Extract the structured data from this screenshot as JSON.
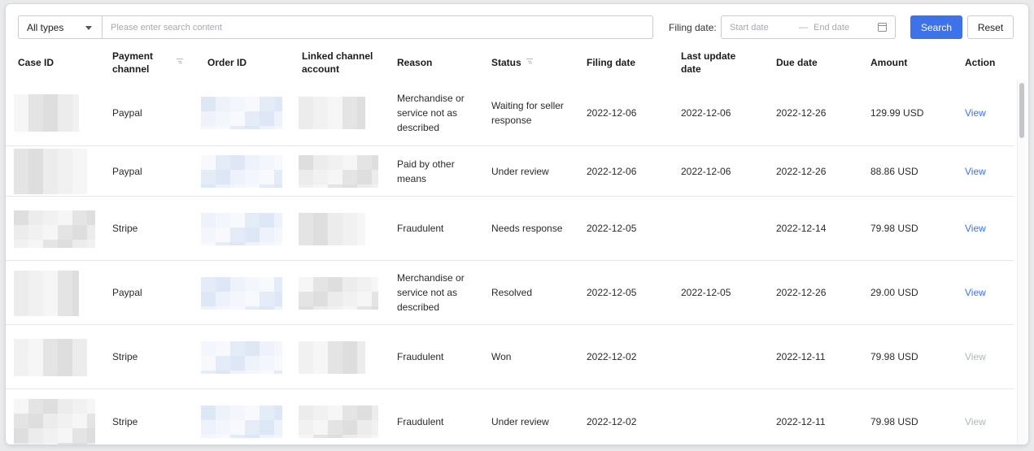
{
  "toolbar": {
    "type_select_value": "All types",
    "search_placeholder": "Please enter search content",
    "filing_date_label": "Filing date:",
    "start_date_placeholder": "Start date",
    "range_separator": "—",
    "end_date_placeholder": "End date",
    "search_button": "Search",
    "reset_button": "Reset"
  },
  "columns": {
    "case_id": "Case ID",
    "payment_channel": "Payment channel",
    "order_id": "Order ID",
    "linked_account": "Linked channel account",
    "reason": "Reason",
    "status": "Status",
    "filing_date": "Filing date",
    "last_update": "Last update date",
    "due_date": "Due date",
    "amount": "Amount",
    "action": "Action"
  },
  "rows": [
    {
      "channel": "Paypal",
      "reason": "Merchandise or service not as described",
      "status": "Waiting for seller response",
      "filing_date": "2022-12-06",
      "last_update": "2022-12-06",
      "due_date": "2022-12-26",
      "amount": "129.99 USD",
      "action": "View",
      "action_enabled": true
    },
    {
      "channel": "Paypal",
      "reason": "Paid by other means",
      "status": "Under review",
      "filing_date": "2022-12-06",
      "last_update": "2022-12-06",
      "due_date": "2022-12-26",
      "amount": "88.86 USD",
      "action": "View",
      "action_enabled": true
    },
    {
      "channel": "Stripe",
      "reason": "Fraudulent",
      "status": "Needs response",
      "filing_date": "2022-12-05",
      "last_update": "",
      "due_date": "2022-12-14",
      "amount": "79.98 USD",
      "action": "View",
      "action_enabled": true
    },
    {
      "channel": "Paypal",
      "reason": "Merchandise or service not as described",
      "status": "Resolved",
      "filing_date": "2022-12-05",
      "last_update": "2022-12-05",
      "due_date": "2022-12-26",
      "amount": "29.00 USD",
      "action": "View",
      "action_enabled": true
    },
    {
      "channel": "Stripe",
      "reason": "Fraudulent",
      "status": "Won",
      "filing_date": "2022-12-02",
      "last_update": "",
      "due_date": "2022-12-11",
      "amount": "79.98 USD",
      "action": "View",
      "action_enabled": false
    },
    {
      "channel": "Stripe",
      "reason": "Fraudulent",
      "status": "Under review",
      "filing_date": "2022-12-02",
      "last_update": "",
      "due_date": "2022-12-11",
      "amount": "79.98 USD",
      "action": "View",
      "action_enabled": false
    }
  ],
  "colors": {
    "primary": "#3d72e8",
    "disabled_link": "#b0b4ba"
  }
}
